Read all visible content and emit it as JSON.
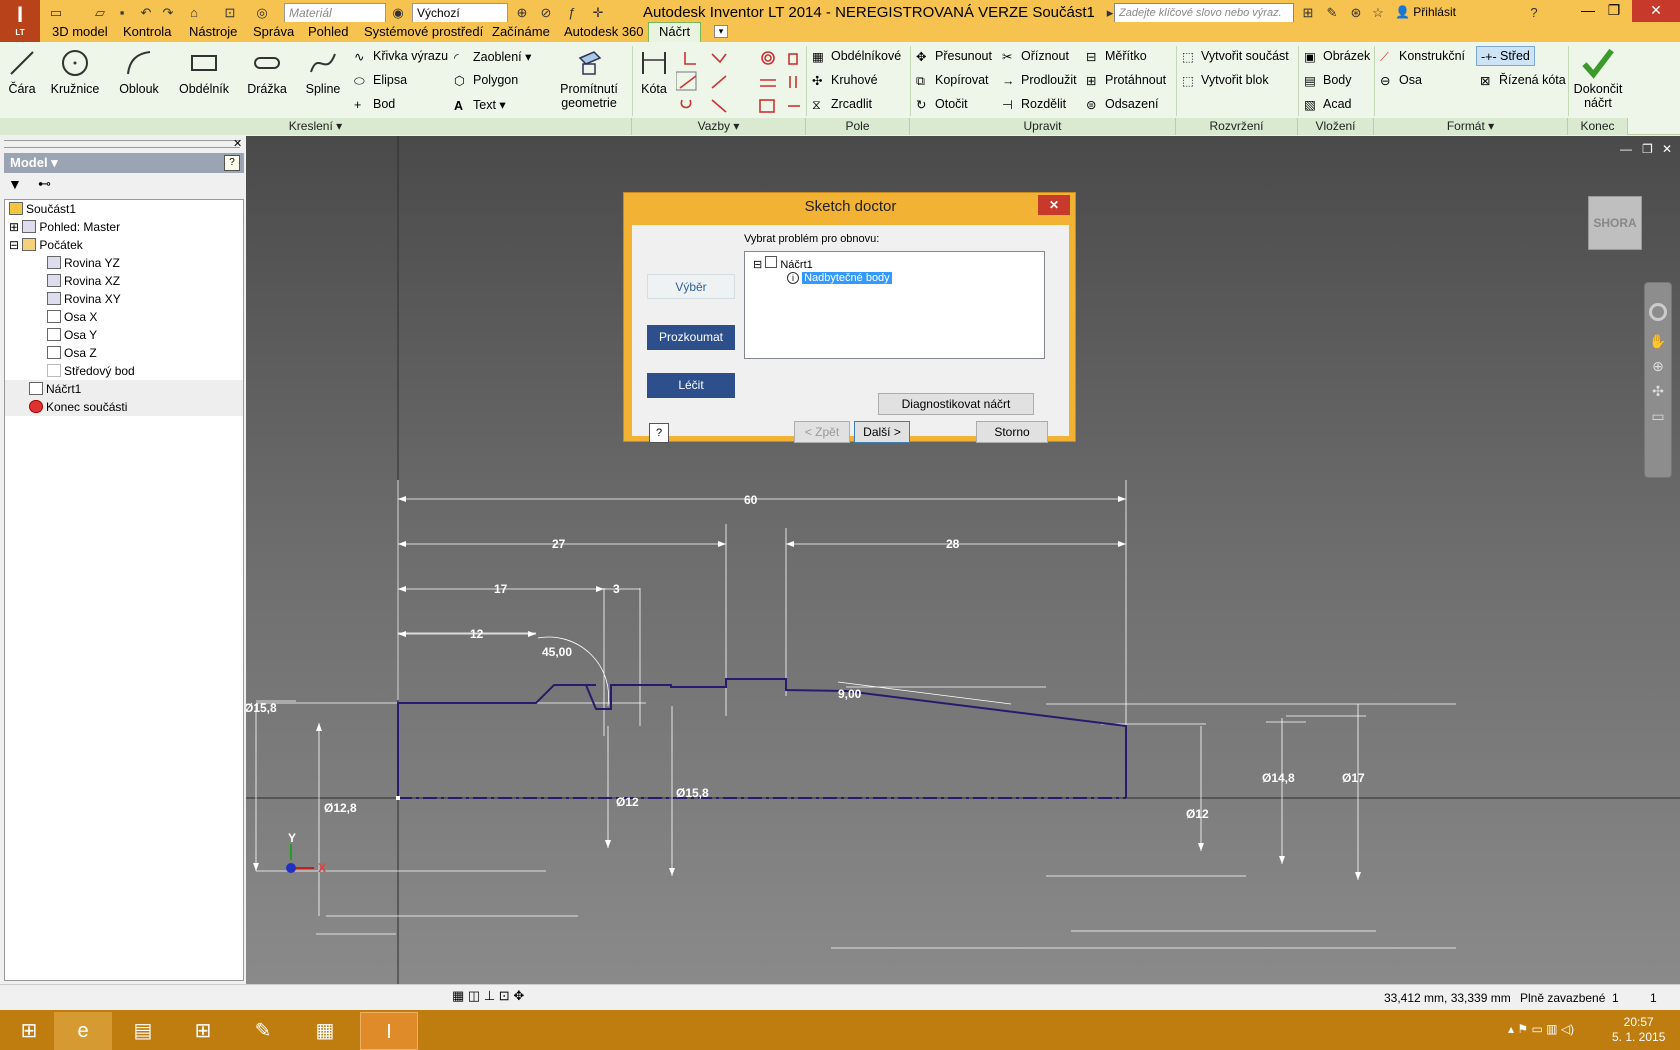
{
  "window": {
    "title": "Autodesk Inventor LT 2014 - NEREGISTROVANÁ VERZE   Součást1",
    "app_badge": "LT",
    "material_combo": "Materiál",
    "appearance_combo": "Výchozí",
    "search_placeholder": "Zadejte klíčové slovo nebo výraz.",
    "signin": "Přihlásit"
  },
  "menu": {
    "tabs": [
      "3D model",
      "Kontrola",
      "Nástroje",
      "Správa",
      "Pohled",
      "Systémové prostředí",
      "Začínáme",
      "Autodesk 360"
    ],
    "active_tab": "Náčrt"
  },
  "ribbon": {
    "draw": {
      "line": "Čára",
      "circle": "Kružnice",
      "arc": "Oblouk",
      "rectangle": "Obdélník",
      "slot": "Drážka",
      "spline": "Spline",
      "equation_curve": "Křivka výrazu",
      "ellipse": "Elipsa",
      "point": "Bod",
      "fillet": "Zaoblení",
      "polygon": "Polygon",
      "text": "Text",
      "project_geometry_1": "Promítnutí",
      "project_geometry_2": "geometrie",
      "panel_label": "Kreslení"
    },
    "constraints": {
      "dimension": "Kóta",
      "panel_label": "Vazby"
    },
    "pattern": {
      "rectangular": "Obdélníkové",
      "circular": "Kruhové",
      "mirror": "Zrcadlit",
      "panel_label": "Pole"
    },
    "modify": {
      "move": "Přesunout",
      "copy": "Kopírovat",
      "rotate": "Otočit",
      "trim": "Oříznout",
      "extend": "Prodloužit",
      "split": "Rozdělit",
      "scale": "Měřítko",
      "stretch": "Protáhnout",
      "offset": "Odsazení",
      "panel_label": "Upravit"
    },
    "layout": {
      "make_part": "Vytvořit součást",
      "make_block": "Vytvořit blok",
      "panel_label": "Rozvržení"
    },
    "insert": {
      "image": "Obrázek",
      "points": "Body",
      "acad": "Acad",
      "panel_label": "Vložení"
    },
    "format": {
      "construction": "Konstrukční",
      "axis": "Osa",
      "center": "Střed",
      "driven_dim": "Řízená kóta",
      "panel_label": "Formát"
    },
    "exit": {
      "finish_1": "Dokončit",
      "finish_2": "náčrt",
      "panel_label": "Konec"
    }
  },
  "browser": {
    "header": "Model",
    "items": [
      {
        "label": "Součást1",
        "indent": 0
      },
      {
        "label": "Pohled: Master",
        "indent": 1
      },
      {
        "label": "Počátek",
        "indent": 1
      },
      {
        "label": "Rovina YZ",
        "indent": 2
      },
      {
        "label": "Rovina XZ",
        "indent": 2
      },
      {
        "label": "Rovina XY",
        "indent": 2
      },
      {
        "label": "Osa X",
        "indent": 2
      },
      {
        "label": "Osa Y",
        "indent": 2
      },
      {
        "label": "Osa Z",
        "indent": 2
      },
      {
        "label": "Středový bod",
        "indent": 2
      },
      {
        "label": "Náčrt1",
        "indent": 1
      },
      {
        "label": "Konec součásti",
        "indent": 1
      }
    ]
  },
  "viewport": {
    "viewcube_label": "SHORA",
    "dimensions": {
      "d60": "60",
      "d27": "27",
      "d28": "28",
      "d17": "17",
      "d3": "3",
      "d12": "12",
      "angle45": "45,00",
      "angle9": "9,00",
      "dia15_8_left": "Ø15,8",
      "dia12_8": "Ø12,8",
      "dia12_a": "Ø12",
      "dia15_8_mid": "Ø15,8",
      "dia12_b": "Ø12",
      "dia14_8": "Ø14,8",
      "dia17": "Ø17"
    },
    "axis_x_label": "X",
    "axis_y_label": "Y"
  },
  "dialog": {
    "title": "Sketch doctor",
    "step_select": "Výběr",
    "step_examine": "Prozkoumat",
    "step_treat": "Léčit",
    "instruction": "Vybrat problém pro obnovu:",
    "tree_root": "Náčrt1",
    "tree_issue": "Nadbytečné body",
    "diagnose_button": "Diagnostikovat náčrt",
    "back_button": "< Zpět",
    "next_button": "Další >",
    "cancel_button": "Storno"
  },
  "status": {
    "coords": "33,412 mm, 33,339 mm",
    "constraint_state": "Plně zavazbené",
    "count_a": "1",
    "count_b": "1"
  },
  "taskbar": {
    "time": "20:57",
    "date": "5. 1. 2015"
  },
  "colors": {
    "title_accent": "#f6c350",
    "ribbon_bg": "#eef5e9",
    "sketch_line": "#2a1a6e",
    "dialog_button": "#2d4f8c",
    "taskbar": "#c07d0f"
  }
}
